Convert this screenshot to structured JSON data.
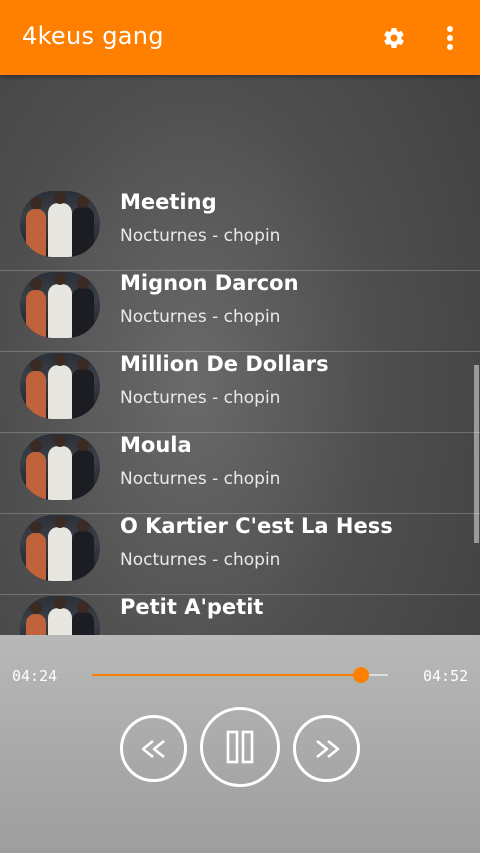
{
  "app": {
    "title": "4keus gang"
  },
  "toolbar": {
    "settings_icon": "gear-icon",
    "more_icon": "more-vert-icon"
  },
  "songs": [
    {
      "title": "Meeting",
      "artist": "Nocturnes - chopin"
    },
    {
      "title": "Mignon Darcon",
      "artist": "Nocturnes - chopin"
    },
    {
      "title": "Million De Dollars",
      "artist": "Nocturnes - chopin"
    },
    {
      "title": "Moula",
      "artist": "Nocturnes - chopin"
    },
    {
      "title": "O Kartier C'est La Hess",
      "artist": "Nocturnes - chopin"
    },
    {
      "title": "Petit A'petit",
      "artist": ""
    }
  ],
  "player": {
    "elapsed": "04:24",
    "duration": "04:52",
    "progress": 0.91,
    "accent_color": "#ff8000",
    "controls": {
      "prev_icon": "rewind-icon",
      "play_icon": "pause-icon",
      "next_icon": "fast-forward-icon"
    }
  }
}
